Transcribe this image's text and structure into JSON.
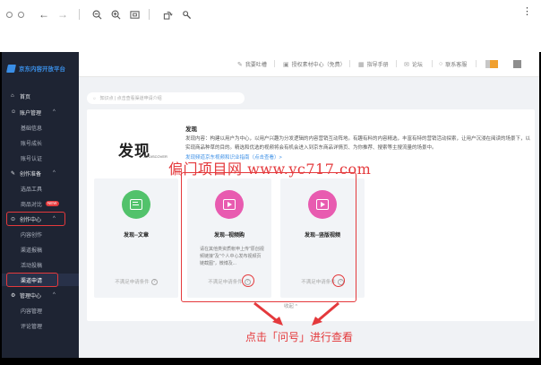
{
  "viewer": {
    "icons": [
      "back-arrow-icon",
      "forward-arrow-icon",
      "zoom-out-icon",
      "zoom-in-icon",
      "fit-icon",
      "rotate-icon",
      "settings-icon",
      "more-icon"
    ]
  },
  "header": {
    "links": [
      {
        "icon": "edit-icon",
        "label": "我要吐槽"
      },
      {
        "icon": "image-icon",
        "label": "授权素材中心（免费）"
      },
      {
        "icon": "book-icon",
        "label": "指导手册"
      },
      {
        "icon": "forum-icon",
        "label": "论坛"
      },
      {
        "icon": "headset-icon",
        "label": "联系客服"
      }
    ]
  },
  "sidebar": {
    "logo": "京东内容开放平台",
    "items": [
      {
        "type": "group",
        "icon": "home-icon",
        "label": "首页"
      },
      {
        "type": "group",
        "icon": "user-icon",
        "label": "账户管理",
        "expanded": true
      },
      {
        "type": "sub",
        "label": "基础信息"
      },
      {
        "type": "sub",
        "label": "账号成长"
      },
      {
        "type": "sub",
        "label": "账号认证"
      },
      {
        "type": "group",
        "icon": "pencil-icon",
        "label": "创作准备",
        "expanded": true
      },
      {
        "type": "sub",
        "label": "选品工具"
      },
      {
        "type": "sub",
        "label": "商品对比",
        "badge": "NEW"
      },
      {
        "type": "group",
        "icon": "create-icon",
        "label": "创作中心",
        "expanded": true
      },
      {
        "type": "sub",
        "label": "内容创作"
      },
      {
        "type": "sub",
        "label": "渠道报稿"
      },
      {
        "type": "sub",
        "label": "活动投稿"
      },
      {
        "type": "sub",
        "label": "渠道申请",
        "active": true
      },
      {
        "type": "group",
        "icon": "manage-icon",
        "label": "管理中心",
        "expanded": true
      },
      {
        "type": "sub",
        "label": "内容管理"
      },
      {
        "type": "sub",
        "label": "评论管理"
      }
    ]
  },
  "notice": "知识点 | 点击查看渠道申请介绍",
  "channel": {
    "logo_text": "发现",
    "logo_sub": "JD DISCOVER",
    "title": "发现",
    "description": "发现内容：构建以用户为中心，以用户兴趣为分发逻辑的内容营销互动阵地。有趣有料的内容精选，丰富有特的营销活动探索，让用户沉浸在阅读的场景下，以实现商品种草的目的。精选和优选的视频将会有机会进入到京东商品详情页、为你推荐、搜索等主搜流量的场景中。",
    "link": "发现频道京东视频和识业指南（点击查看）>"
  },
  "watermark": "偏门项目网 www.yc717.com",
  "cards": [
    {
      "title": "发现--文章",
      "icon": "article-icon",
      "color": "#52c26b",
      "desc": "",
      "status": "不满足申请条件"
    },
    {
      "title": "发现--视频购",
      "icon": "video-buy-icon",
      "color": "#e85bb0",
      "desc": "请在其他类资质帐申上传\"原创视频链接\"及\"个人中心发布视频页链截图\"，微博及...",
      "status": "不满足申请条件"
    },
    {
      "title": "发现--竖版视频",
      "icon": "vertical-video-icon",
      "color": "#e85bb0",
      "desc": "",
      "status": "不满足申请条件"
    }
  ],
  "collapse_label": "收起 ^",
  "annotation": "点击「问号」进行查看",
  "colors": {
    "accent": "#3a8ee6",
    "annotation_red": "#e4393c",
    "sidebar_bg": "#1e2433"
  }
}
